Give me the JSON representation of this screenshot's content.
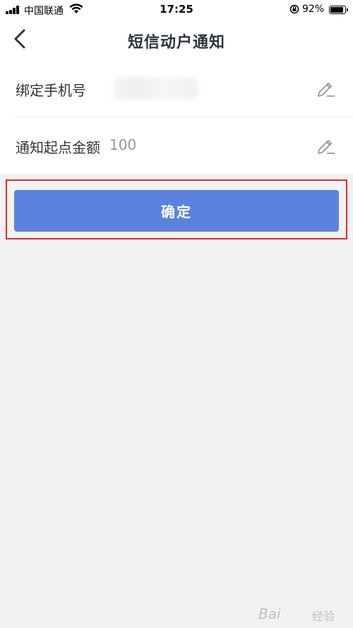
{
  "status_bar": {
    "carrier": "中国联通",
    "time": "17:25",
    "battery_percent": "92%",
    "battery_level": 0.92
  },
  "nav": {
    "title": "短信动户通知",
    "back_icon": "chevron-left-icon"
  },
  "form": {
    "phone": {
      "label": "绑定手机号",
      "value_redacted": true,
      "edit_icon": "pencil-icon"
    },
    "amount": {
      "label": "通知起点金额",
      "value": "100",
      "edit_icon": "pencil-icon"
    }
  },
  "confirm_button": {
    "label": "确定"
  },
  "watermark": {
    "text": "Bai",
    "text2": "经验"
  },
  "colors": {
    "primary_button": "#5b82dc",
    "highlight_border": "#e32b2b",
    "background": "#f2f2f2",
    "title": "#2e3441"
  }
}
